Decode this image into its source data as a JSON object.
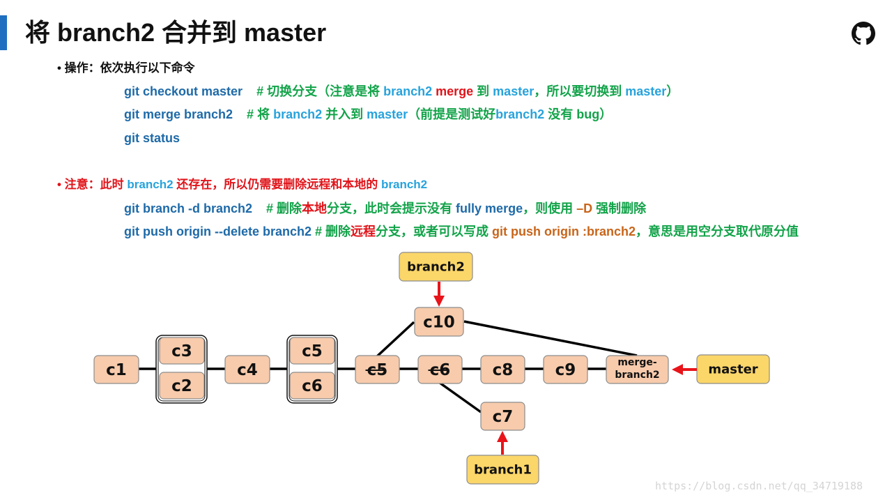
{
  "title": "将 branch2 合并到 master",
  "icons": {
    "logo": "github-icon"
  },
  "section1": {
    "bullet": "• 操作：依次执行以下命令",
    "commands": [
      {
        "segments": [
          {
            "text": "git checkout master",
            "color": "dark"
          },
          {
            "text": "    # 切换分支（注意是将 ",
            "color": "green"
          },
          {
            "text": "branch2 ",
            "color": "light"
          },
          {
            "text": "merge",
            "color": "red"
          },
          {
            "text": " 到 ",
            "color": "green"
          },
          {
            "text": "master",
            "color": "light"
          },
          {
            "text": "，所以要切换到 ",
            "color": "green"
          },
          {
            "text": "master",
            "color": "light"
          },
          {
            "text": "）",
            "color": "green"
          }
        ]
      },
      {
        "segments": [
          {
            "text": "git merge branch2",
            "color": "dark"
          },
          {
            "text": "    # 将 ",
            "color": "green"
          },
          {
            "text": "branch2",
            "color": "light"
          },
          {
            "text": " 并入到 ",
            "color": "green"
          },
          {
            "text": "master",
            "color": "light"
          },
          {
            "text": "（前提是测试好",
            "color": "green"
          },
          {
            "text": "branch2",
            "color": "light"
          },
          {
            "text": " 没有 bug）",
            "color": "green"
          }
        ]
      },
      {
        "segments": [
          {
            "text": "git status",
            "color": "dark"
          }
        ]
      }
    ]
  },
  "section2": {
    "bullet_segments": [
      {
        "text": "• 注意：此时 ",
        "color": "red"
      },
      {
        "text": "branch2",
        "color": "light"
      },
      {
        "text": " 还存在，所以仍需要删除远程和本地的 ",
        "color": "red"
      },
      {
        "text": "branch2",
        "color": "light"
      }
    ],
    "commands": [
      {
        "segments": [
          {
            "text": "git branch -d branch2",
            "color": "dark"
          },
          {
            "text": "    # 删除",
            "color": "green"
          },
          {
            "text": "本地",
            "color": "red"
          },
          {
            "text": "分支，此时会提示没有 ",
            "color": "green"
          },
          {
            "text": "fully merge",
            "color": "dark"
          },
          {
            "text": "，则使用 ",
            "color": "green"
          },
          {
            "text": "–D",
            "color": "orange"
          },
          {
            "text": " 强制删除",
            "color": "green"
          }
        ]
      },
      {
        "segments": [
          {
            "text": "git push origin --delete branch2",
            "color": "dark"
          },
          {
            "text": " # 删除",
            "color": "green"
          },
          {
            "text": "远程",
            "color": "red"
          },
          {
            "text": "分支，或者可以写成 ",
            "color": "green"
          },
          {
            "text": "git push origin :branch2",
            "color": "orange"
          },
          {
            "text": "，意思是用空分支取代原分值",
            "color": "green"
          }
        ]
      }
    ]
  },
  "diagram": {
    "colors": {
      "commit_fill": "#f7cbac",
      "commit_stroke": "#8c8c8c",
      "branch_fill": "#fbd669",
      "arrow": "#e8141a",
      "edge": "#000000"
    },
    "commits": [
      {
        "id": "c1",
        "label": "c1"
      },
      {
        "id": "c3",
        "label": "c3"
      },
      {
        "id": "c2",
        "label": "c2"
      },
      {
        "id": "c4",
        "label": "c4"
      },
      {
        "id": "c5a",
        "label": "c5"
      },
      {
        "id": "c6a",
        "label": "c6"
      },
      {
        "id": "c5b",
        "label": "c5",
        "strikethrough": true
      },
      {
        "id": "c6b",
        "label": "c6",
        "strikethrough": true
      },
      {
        "id": "c8",
        "label": "c8"
      },
      {
        "id": "c9",
        "label": "c9"
      },
      {
        "id": "c10",
        "label": "c10"
      },
      {
        "id": "c7",
        "label": "c7"
      },
      {
        "id": "merge",
        "label": "merge-|branch2"
      }
    ],
    "groups": [
      {
        "id": "g1",
        "members": [
          "c3",
          "c2"
        ]
      },
      {
        "id": "g2",
        "members": [
          "c5a",
          "c6a"
        ]
      }
    ],
    "edges": [
      [
        "c1",
        "g1"
      ],
      [
        "g1",
        "c4"
      ],
      [
        "c4",
        "g2"
      ],
      [
        "g2",
        "c5b"
      ],
      [
        "c5b",
        "c6b"
      ],
      [
        "c6b",
        "c8"
      ],
      [
        "c8",
        "c9"
      ],
      [
        "c9",
        "merge"
      ],
      [
        "c5b",
        "c10"
      ],
      [
        "c10",
        "merge"
      ],
      [
        "c6b",
        "c7"
      ]
    ],
    "branches": [
      {
        "id": "branch2",
        "label": "branch2",
        "points_to": "c10"
      },
      {
        "id": "master",
        "label": "master",
        "points_to": "merge"
      },
      {
        "id": "branch1",
        "label": "branch1",
        "points_to": "c7"
      }
    ]
  },
  "watermark": "https://blog.csdn.net/qq_34719188"
}
